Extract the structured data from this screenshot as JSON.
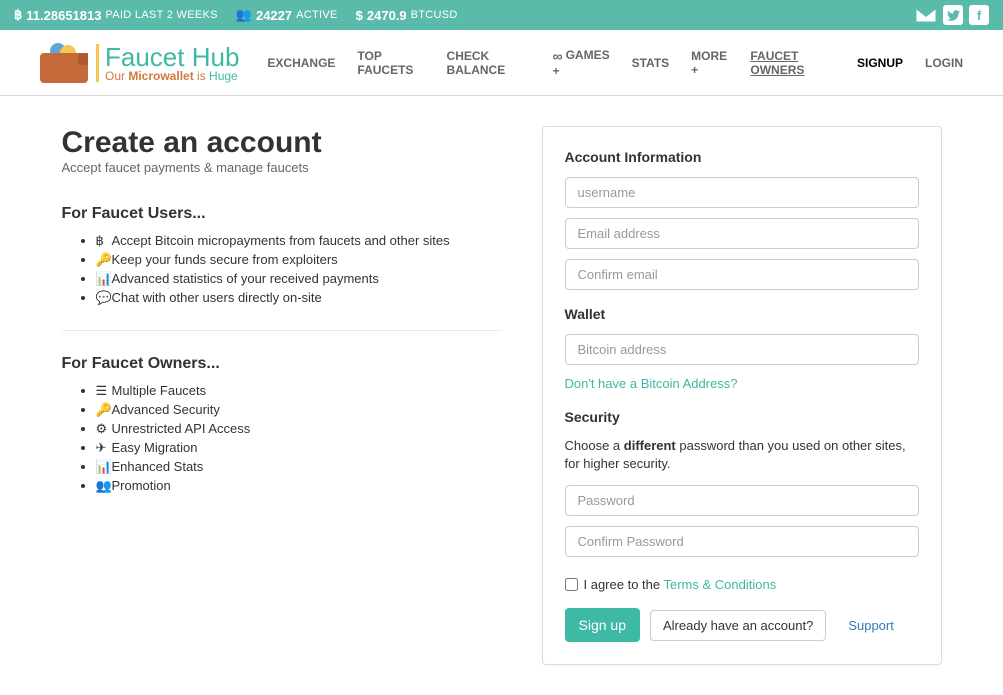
{
  "topbar": {
    "paid_val": "11.28651813",
    "paid_lbl": "PAID LAST 2 WEEKS",
    "active_val": "24227",
    "active_lbl": "ACTIVE",
    "price_val": "2470.9",
    "price_lbl": "BTCUSD"
  },
  "logo": {
    "line1": "Faucet Hub",
    "line2_a": "Our ",
    "line2_b": "Microwallet",
    "line2_c": " is ",
    "line2_d": "Huge"
  },
  "nav": {
    "exchange": "EXCHANGE",
    "top_faucets": "TOP FAUCETS",
    "check_balance": "CHECK BALANCE",
    "games": "GAMES +",
    "stats": "STATS",
    "more": "MORE +",
    "faucet_owners": "FAUCET OWNERS",
    "signup": "SIGNUP",
    "login": "LOGIN"
  },
  "page": {
    "title": "Create an account",
    "subtitle": "Accept faucet payments & manage faucets"
  },
  "users_h": "For Faucet Users...",
  "users_list": [
    "Accept Bitcoin micropayments from faucets and other sites",
    "Keep your funds secure from exploiters",
    "Advanced statistics of your received payments",
    "Chat with other users directly on-site"
  ],
  "owners_h": "For Faucet Owners...",
  "owners_list": [
    "Multiple Faucets",
    "Advanced Security",
    "Unrestricted API Access",
    "Easy Migration",
    "Enhanced Stats",
    "Promotion"
  ],
  "form": {
    "account_h": "Account Information",
    "username_ph": "username",
    "email_ph": "Email address",
    "confirm_email_ph": "Confirm email",
    "wallet_h": "Wallet",
    "bitcoin_ph": "Bitcoin address",
    "no_addr": "Don't have a Bitcoin Address?",
    "security_h": "Security",
    "sec_help_a": "Choose a ",
    "sec_help_b": "different",
    "sec_help_c": " password than you used on other sites, for higher security.",
    "password_ph": "Password",
    "confirm_pw_ph": "Confirm Password",
    "agree_a": "I agree to the ",
    "agree_b": "Terms & Conditions",
    "signup_btn": "Sign up",
    "already": "Already have an account?",
    "support": "Support"
  }
}
